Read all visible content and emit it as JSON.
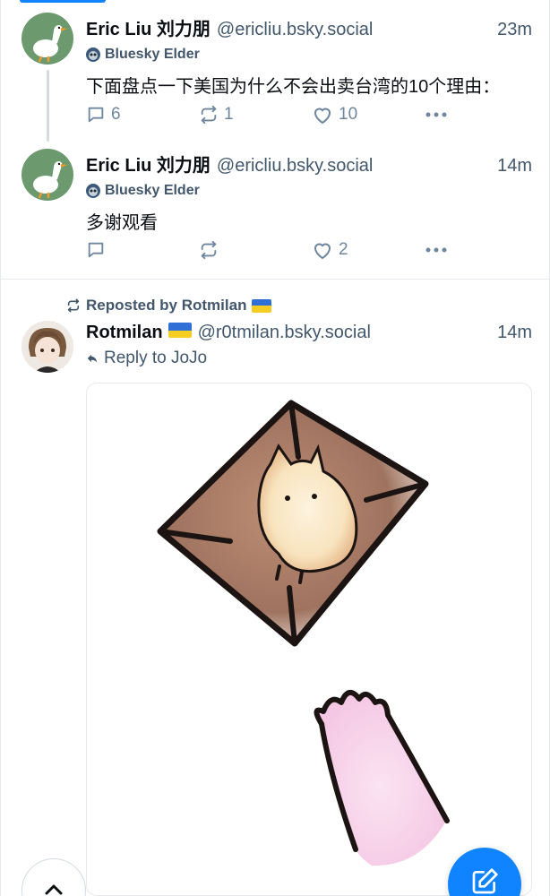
{
  "posts": [
    {
      "display_name": "Eric Liu 刘力朋",
      "handle": "@ericliu.bsky.social",
      "time": "23m",
      "badge": "Bluesky Elder",
      "text": "下面盘点一下美国为什么不会出卖台湾的10个理由：",
      "replies": "6",
      "reposts": "1",
      "likes": "10"
    },
    {
      "display_name": "Eric Liu 刘力朋",
      "handle": "@ericliu.bsky.social",
      "time": "14m",
      "badge": "Bluesky Elder",
      "text": "多谢观看",
      "replies": "",
      "reposts": "",
      "likes": "2"
    }
  ],
  "repost": {
    "label": "Reposted by Rotmilan",
    "display_name": "Rotmilan",
    "handle": "@r0tmilan.bsky.social",
    "time": "14m",
    "reply_to": "Reply to JoJo"
  },
  "icons": {
    "reply": "comment-icon",
    "repost": "repost-icon",
    "like": "heart-icon",
    "more": "more-icon",
    "compose": "compose-icon",
    "scroll_top": "chevron-up-icon"
  },
  "colors": {
    "accent": "#1083fe",
    "muted": "#6f869f",
    "secondary_text": "#42576c"
  }
}
